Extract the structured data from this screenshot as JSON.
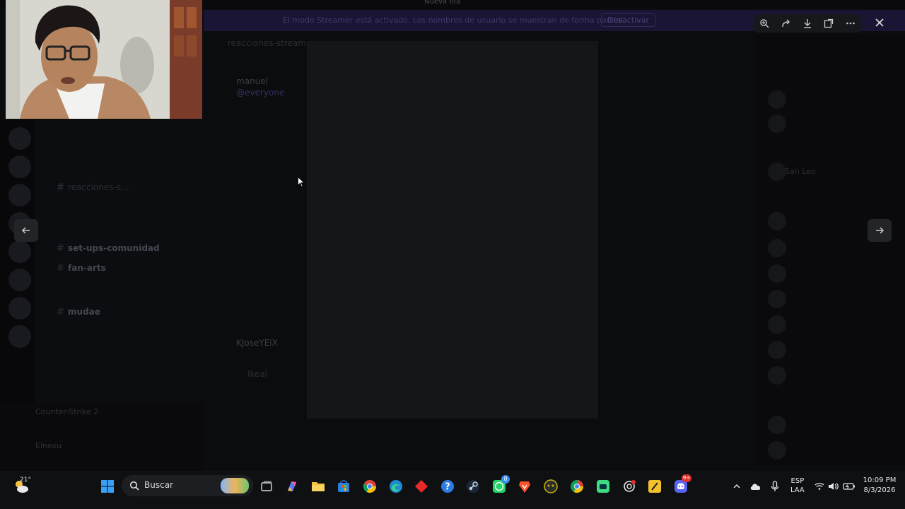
{
  "window": {
    "title": "Nueva fifa"
  },
  "banner": {
    "text": "El modo Streamer está activado. Los nombres de usuario se muestran de forma parcial.",
    "button": "Desactivar"
  },
  "chat": {
    "channel_header": "reacciones-stream",
    "messages": [
      {
        "author": "manuel",
        "text": "@everyone"
      },
      {
        "author": "KJoseYElX",
        "text": "Ikeal"
      }
    ]
  },
  "channels": [
    {
      "label": "reacciones-s...",
      "emphasis": false
    },
    {
      "label": "set-ups-comunidad",
      "emphasis": true
    },
    {
      "label": "fan-arts",
      "emphasis": true
    },
    {
      "label": "mudae",
      "emphasis": true
    }
  ],
  "user_panel": {
    "game": "Counter-Strike 2",
    "username": "Elnexu"
  },
  "members": [
    {
      "name": "San Leo"
    }
  ],
  "viewer": {
    "toolbar": [
      "zoom-in-icon",
      "share-icon",
      "download-icon",
      "open-external-icon",
      "more-icon"
    ],
    "close_icon": "close-icon",
    "prev_icon": "arrow-left-icon",
    "next_icon": "arrow-right-icon"
  },
  "taskbar": {
    "weather_temp": "21°",
    "search_label": "Buscar",
    "language_line1": "ESP",
    "language_line2": "LAA",
    "time": "10:09 PM",
    "date": "8/3/2026",
    "whatsapp_badge": "8",
    "discord_badge": "9+"
  },
  "colors": {
    "overlay_bg": "#0b0c0e",
    "image_bg": "#131718",
    "taskbar_bg": "#0f1012",
    "discord_accent": "#5865f2",
    "banner_bg": "#1a1534"
  }
}
